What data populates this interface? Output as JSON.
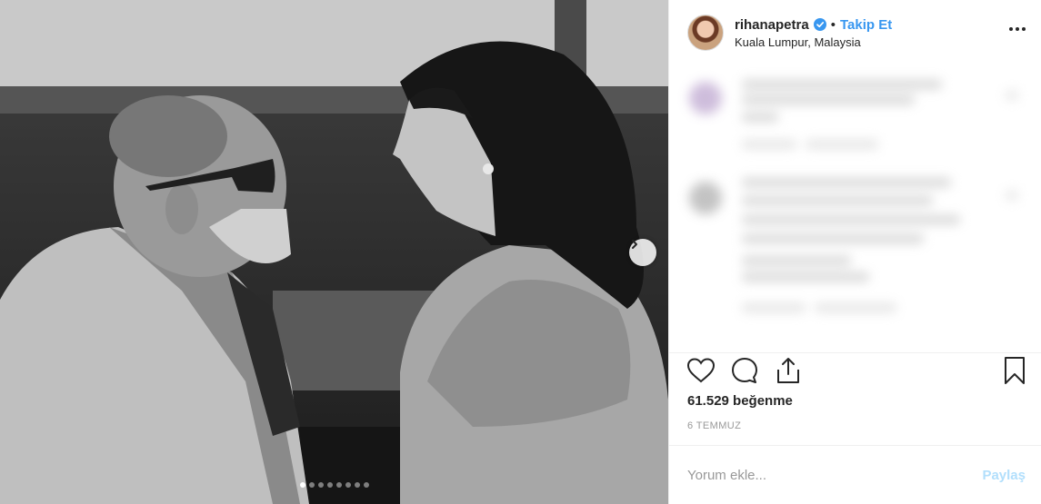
{
  "post": {
    "username": "rihanapetra",
    "follow_label": "Takip Et",
    "separator": "•",
    "location": "Kuala Lumpur, Malaysia",
    "likes_text": "61.529 beğenme",
    "date_text": "6 TEMMUZ",
    "comment_placeholder": "Yorum ekle...",
    "share_label": "Paylaş",
    "carousel": {
      "total": 8,
      "active_index": 0
    }
  },
  "icons": {
    "verified": "verified-badge-icon",
    "more": "more-options-icon",
    "like": "heart-icon",
    "comment": "comment-bubble-icon",
    "share": "share-icon",
    "save": "bookmark-icon",
    "next": "chevron-right-icon"
  },
  "colors": {
    "accent": "#3897f0",
    "share_disabled": "#b2dffc",
    "text": "#262626",
    "muted": "#999999"
  }
}
